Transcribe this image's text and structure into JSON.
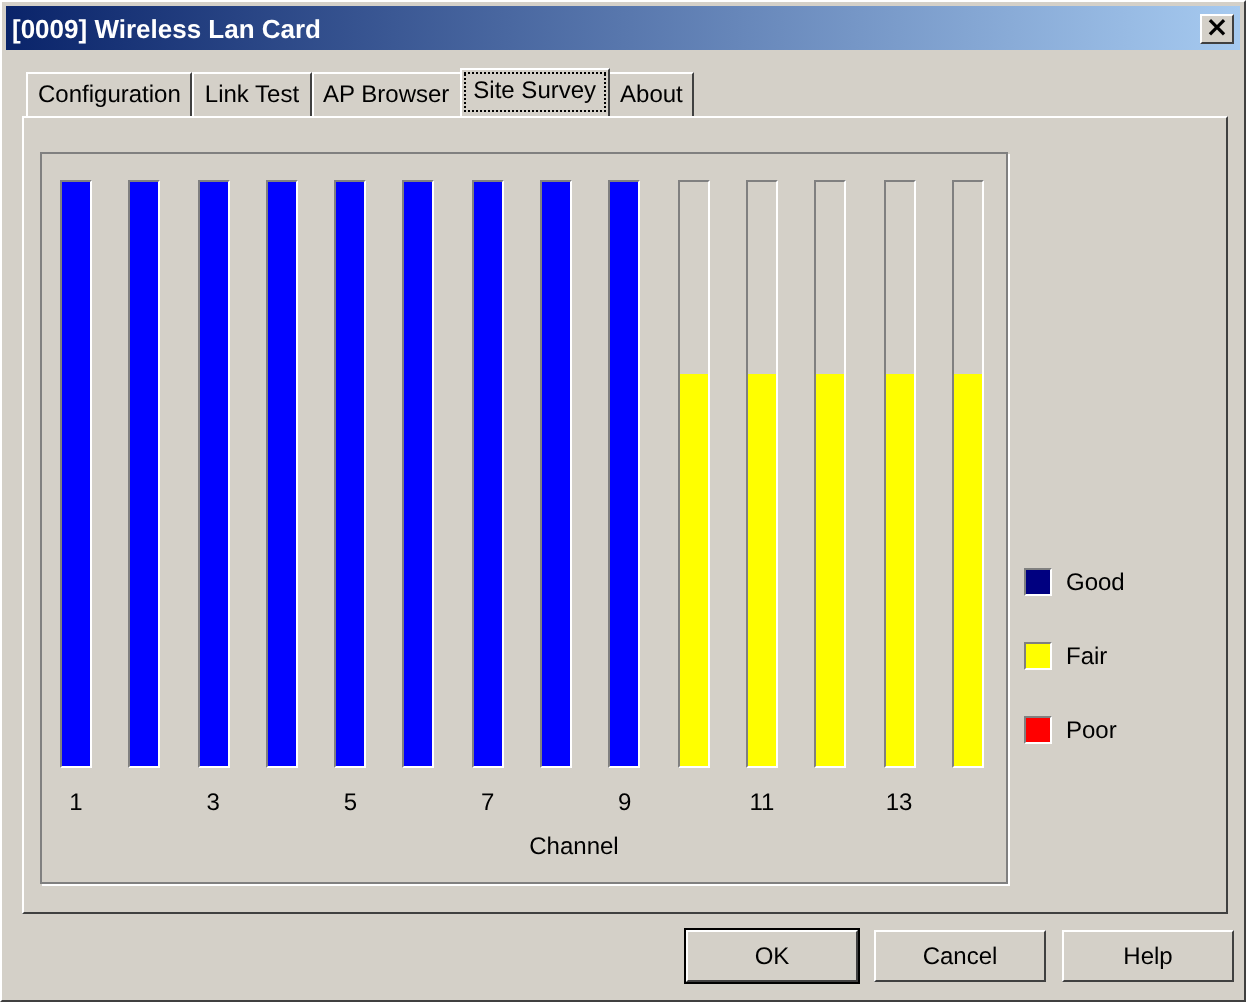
{
  "window": {
    "title": "[0009] Wireless Lan Card",
    "close": "×"
  },
  "tabs": [
    {
      "label": "Configuration",
      "selected": false
    },
    {
      "label": "Link Test",
      "selected": false
    },
    {
      "label": "AP Browser",
      "selected": false
    },
    {
      "label": "Site Survey",
      "selected": true
    },
    {
      "label": "About",
      "selected": false
    }
  ],
  "channels": [
    {
      "label": "1",
      "level": 1,
      "color": "#0000ff"
    },
    {
      "level": 1,
      "color": "#0000ff"
    },
    {
      "label": "3",
      "level": 1,
      "color": "#0000ff"
    },
    {
      "level": 1,
      "color": "#0000ff"
    },
    {
      "label": "5",
      "level": 1,
      "color": "#0000ff"
    },
    {
      "level": 1,
      "color": "#0000ff"
    },
    {
      "label": "7",
      "level": 1,
      "color": "#0000ff"
    },
    {
      "level": 1,
      "color": "#0000ff"
    },
    {
      "label": "9",
      "level": 1,
      "color": "#0000ff"
    },
    {
      "level": 0.67,
      "color": "#ffff00"
    },
    {
      "label": "11",
      "level": 0.67,
      "color": "#ffff00"
    },
    {
      "level": 0.67,
      "color": "#ffff00"
    },
    {
      "label": "13",
      "level": 0.67,
      "color": "#ffff00"
    },
    {
      "level": 0.67,
      "color": "#ffff00"
    }
  ],
  "axis_label": "Channel",
  "legend": [
    {
      "label": "Good",
      "color": "#000080"
    },
    {
      "label": "Fair",
      "color": "#ffff00"
    },
    {
      "label": "Poor",
      "color": "#ff0000"
    }
  ],
  "buttons": [
    {
      "label": "OK",
      "default": true
    },
    {
      "label": "Cancel",
      "default": false
    },
    {
      "label": "Help",
      "default": false
    }
  ]
}
